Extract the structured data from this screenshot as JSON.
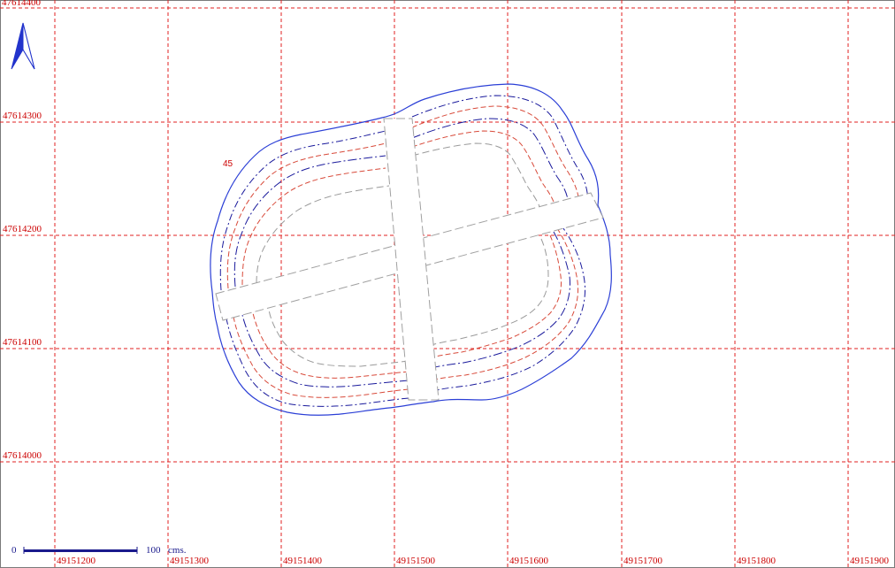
{
  "map": {
    "grid": {
      "x_labels": [
        "49151200",
        "49151300",
        "49151400",
        "49151500",
        "49151600",
        "49151700",
        "49151800",
        "49151900"
      ],
      "y_labels": [
        "47614400",
        "47614300",
        "47614200",
        "47614100",
        "47614000"
      ],
      "line_color": "#e02020"
    },
    "contour_label": "45",
    "contour_colors": {
      "outline": "#2b3fd6",
      "navy": "#1a1a9c",
      "red": "#d84a3a",
      "gray": "#9a9a9a"
    },
    "north_arrow_icon": "north-arrow-icon",
    "scale_bar": {
      "start_label": "0",
      "end_label": "100",
      "unit_label": "cms."
    }
  }
}
